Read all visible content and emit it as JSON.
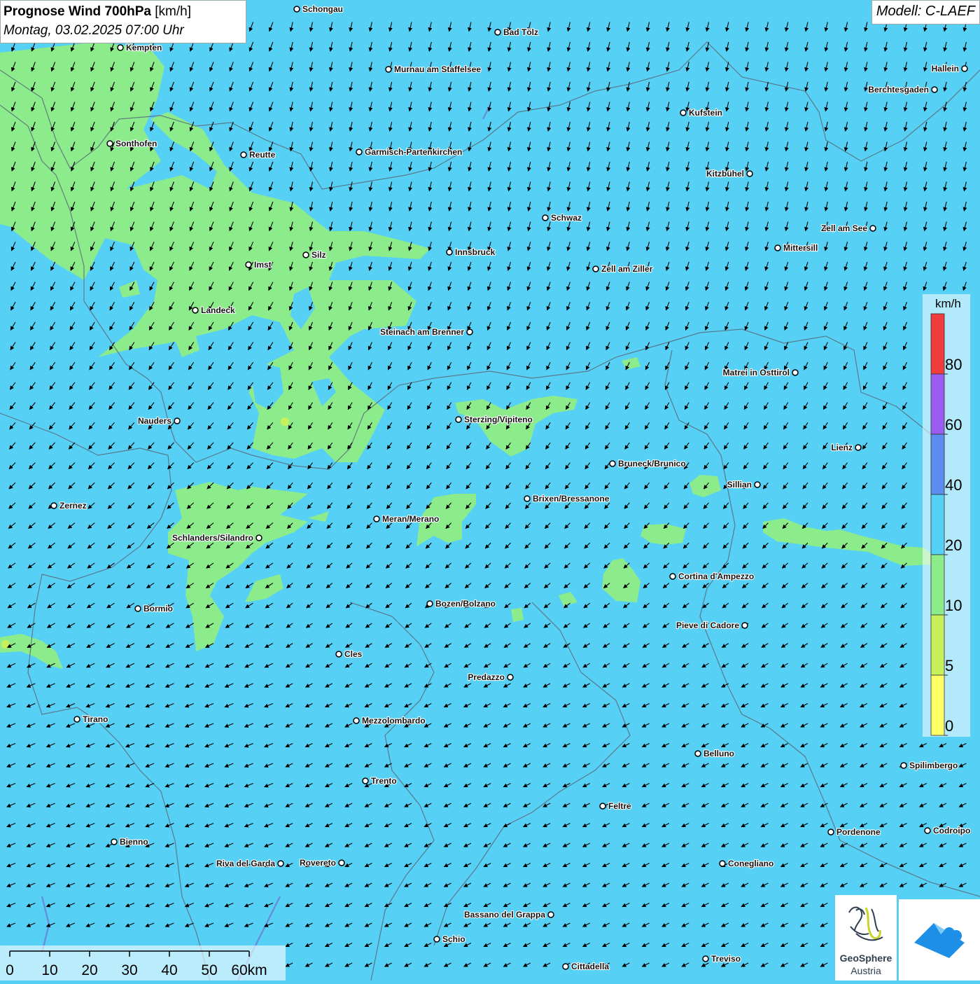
{
  "header": {
    "title_bold": "Prognose Wind 700hPa",
    "title_unit": "[km/h]",
    "datetime": "Montag, 03.02.2025 07:00 Uhr",
    "model": "Modell: C-LAEF"
  },
  "colors": {
    "wind_0_5": "#ffff66",
    "wind_5_10": "#c8f05a",
    "wind_10_20": "#8cec8c",
    "wind_20_40": "#56d0f5",
    "wind_40_60": "#5b8cf0",
    "wind_60_80": "#9b5cf0",
    "wind_80_plus": "#f03c3c"
  },
  "legend": {
    "unit": "km/h",
    "labels": [
      "80",
      "60",
      "40",
      "20",
      "10",
      "5",
      "0"
    ]
  },
  "scalebar": {
    "labels": [
      "0",
      "10",
      "20",
      "30",
      "40",
      "50",
      "60km"
    ]
  },
  "wind": {
    "direction": "from north / north-east",
    "speed_class_dominant": "20-40 km/h"
  },
  "cities": [
    {
      "name": "Schongau"
    },
    {
      "name": "Bad Tölz"
    },
    {
      "name": "Kempten"
    },
    {
      "name": "Murnau am Staffelsee"
    },
    {
      "name": "Hallein"
    },
    {
      "name": "Berchtesgaden"
    },
    {
      "name": "Kufstein"
    },
    {
      "name": "Sonthofen"
    },
    {
      "name": "Reutte"
    },
    {
      "name": "Garmisch-Partenkirchen"
    },
    {
      "name": "Kitzbühel"
    },
    {
      "name": "Schwaz"
    },
    {
      "name": "Zell am See"
    },
    {
      "name": "Mittersill"
    },
    {
      "name": "Innsbruck"
    },
    {
      "name": "Silz"
    },
    {
      "name": "Imst"
    },
    {
      "name": "Zell am Ziller"
    },
    {
      "name": "Landeck"
    },
    {
      "name": "Steinach am Brenner"
    },
    {
      "name": "Matrei in Osttirol"
    },
    {
      "name": "Nauders"
    },
    {
      "name": "Sterzing/Vipiteno"
    },
    {
      "name": "Lienz"
    },
    {
      "name": "Bruneck/Brunico"
    },
    {
      "name": "Sillian"
    },
    {
      "name": "Brixen/Bressanone"
    },
    {
      "name": "Zernez"
    },
    {
      "name": "Meran/Merano"
    },
    {
      "name": "Schlanders/Silandro"
    },
    {
      "name": "Cortina d'Ampezzo"
    },
    {
      "name": "Bozen/Bolzano"
    },
    {
      "name": "Bormio"
    },
    {
      "name": "Pieve di Cadore"
    },
    {
      "name": "Cles"
    },
    {
      "name": "Predazzo"
    },
    {
      "name": "Tirano"
    },
    {
      "name": "Mezzolombardo"
    },
    {
      "name": "Belluno"
    },
    {
      "name": "Spilimbergo"
    },
    {
      "name": "Trento"
    },
    {
      "name": "Feltre"
    },
    {
      "name": "Pordenone"
    },
    {
      "name": "Codroipo"
    },
    {
      "name": "Bienno"
    },
    {
      "name": "Riva del Garda"
    },
    {
      "name": "Rovereto"
    },
    {
      "name": "Conegliano"
    },
    {
      "name": "Bassano del Grappa"
    },
    {
      "name": "Schio"
    },
    {
      "name": "Treviso"
    },
    {
      "name": "Cittadella"
    }
  ],
  "logos": {
    "geosphere_line1": "GeoSphere",
    "geosphere_line2": "Austria"
  }
}
